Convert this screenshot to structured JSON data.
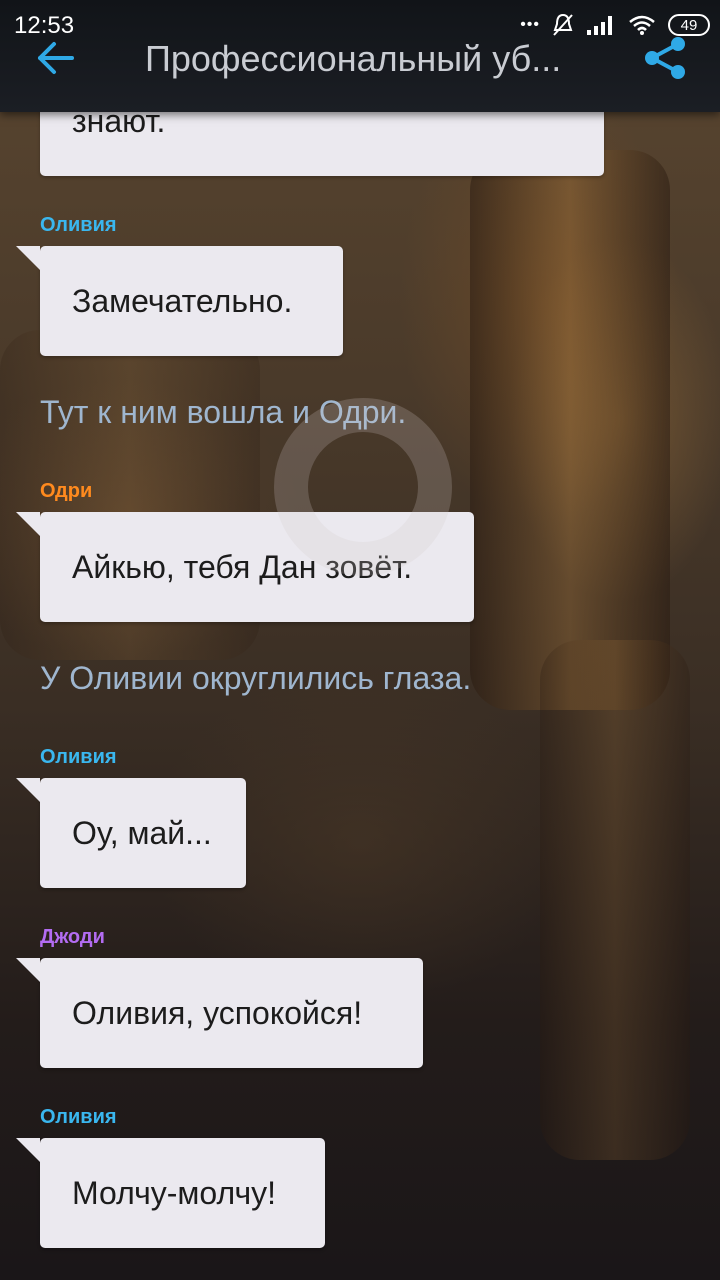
{
  "status_bar": {
    "time": "12:53",
    "dots": "•••",
    "battery_level": "49"
  },
  "app_bar": {
    "title": "Профессиональный уб...",
    "accent_color": "#2fa9e6"
  },
  "colors": {
    "olivia": "#3ab7ef",
    "odri": "#ff8a1e",
    "jodi": "#b36cf2",
    "narration": "#9fb6cf",
    "bubble": "#ebe9ef"
  },
  "messages": [
    {
      "type": "bubble",
      "text": "знают."
    },
    {
      "type": "speaker",
      "name": "Оливия"
    },
    {
      "type": "bubble",
      "text": "Замечательно."
    },
    {
      "type": "narration",
      "text": "Тут к ним вошла и Одри."
    },
    {
      "type": "speaker",
      "name": "Одри"
    },
    {
      "type": "bubble",
      "text": "Айкью, тебя Дан зовёт."
    },
    {
      "type": "narration",
      "text": "У Оливии округлились глаза."
    },
    {
      "type": "speaker",
      "name": "Оливия"
    },
    {
      "type": "bubble",
      "text": "Оу, май..."
    },
    {
      "type": "speaker",
      "name": "Джоди"
    },
    {
      "type": "bubble",
      "text": "Оливия, успокойся!"
    },
    {
      "type": "speaker",
      "name": "Оливия"
    },
    {
      "type": "bubble",
      "text": "Молчу-молчу!"
    }
  ]
}
